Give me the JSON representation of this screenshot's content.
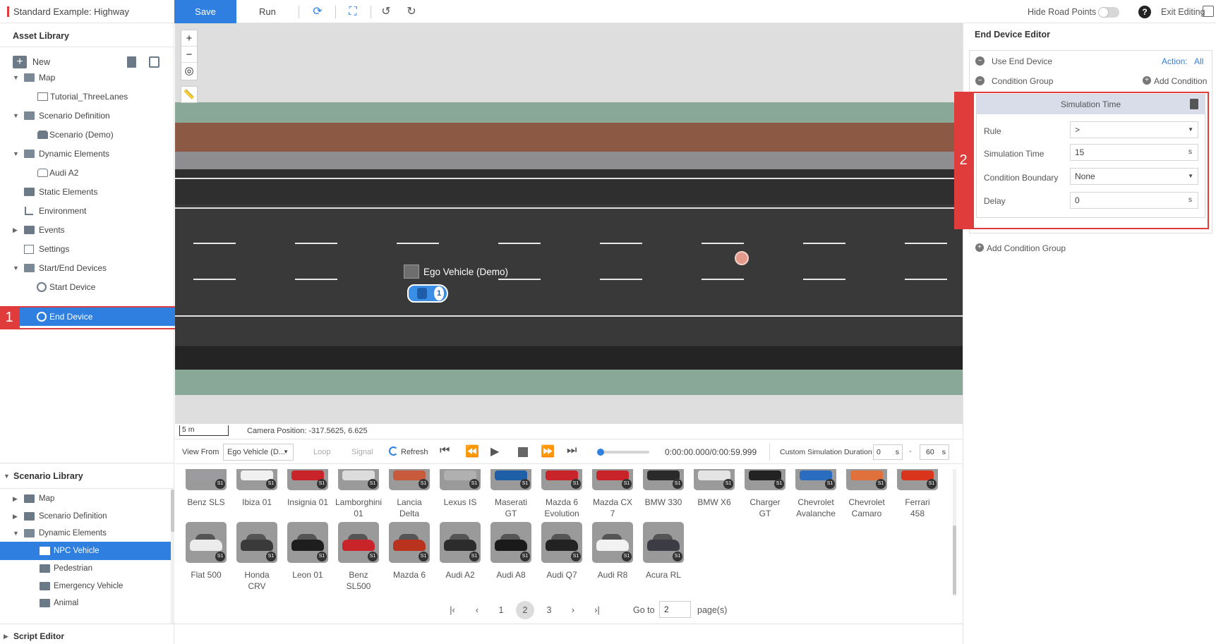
{
  "app": {
    "title": "Standard Example: Highway"
  },
  "toolbar": {
    "save_label": "Save",
    "run_label": "Run",
    "hide_road_points_label": "Hide Road Points",
    "help_label": "?",
    "exit_editing_label": "Exit Editing"
  },
  "asset_library": {
    "title": "Asset Library",
    "new_label": "New",
    "tree": [
      {
        "label": "Map"
      },
      {
        "label": "Tutorial_ThreeLanes"
      },
      {
        "label": "Scenario Definition"
      },
      {
        "label": "Scenario (Demo)"
      },
      {
        "label": "Dynamic Elements"
      },
      {
        "label": "Audi A2"
      },
      {
        "label": "Static Elements"
      },
      {
        "label": "Environment"
      },
      {
        "label": "Events"
      },
      {
        "label": "Settings"
      },
      {
        "label": "Start/End Devices"
      },
      {
        "label": "Start Device"
      },
      {
        "label": "End Device"
      }
    ]
  },
  "annotations": {
    "marker1": "1",
    "marker2": "2"
  },
  "viewport": {
    "zoom_in": "+",
    "zoom_out": "−",
    "ego_label": "Ego Vehicle (Demo)",
    "ego_number": "1",
    "scale_label": "5 m",
    "camera_position": "Camera Position: -317.5625, 6.625"
  },
  "playback": {
    "view_from_label": "View From",
    "view_from_value": "Ego Vehicle (D...",
    "loop_label": "Loop",
    "signal_label": "Signal",
    "refresh_label": "Refresh",
    "time_display": "0:00:00.000/0:00:59.999",
    "custom_duration_label": "Custom Simulation Duration",
    "duration_start": "0",
    "duration_end": "60",
    "unit": "s",
    "dash": "-",
    "progress": 0
  },
  "scenario_library": {
    "title": "Scenario Library",
    "tree": [
      {
        "label": "Map"
      },
      {
        "label": "Scenario Definition"
      },
      {
        "label": "Dynamic Elements"
      },
      {
        "label": "NPC Vehicle"
      },
      {
        "label": "Pedestrian"
      },
      {
        "label": "Emergency Vehicle"
      },
      {
        "label": "Animal"
      }
    ],
    "badge": "S1",
    "row1": [
      {
        "line1": "Benz SLS",
        "line2": "",
        "color": "#9c9ca0"
      },
      {
        "line1": "Ibiza 01",
        "line2": "",
        "color": "#f0f0f0"
      },
      {
        "line1": "Insignia 01",
        "line2": "",
        "color": "#c8242a"
      },
      {
        "line1": "Lamborghini",
        "line2": "01",
        "color": "#dcdcdc"
      },
      {
        "line1": "Lancia",
        "line2": "Delta",
        "color": "#c85a3c"
      },
      {
        "line1": "Lexus IS",
        "line2": "",
        "color": "#b0b0b0"
      },
      {
        "line1": "Maserati",
        "line2": "GT",
        "color": "#1f5fa8"
      },
      {
        "line1": "Mazda 6",
        "line2": "Evolution",
        "color": "#c8242a"
      },
      {
        "line1": "Mazda CX",
        "line2": "7",
        "color": "#c8242a"
      },
      {
        "line1": "BMW 330",
        "line2": "",
        "color": "#2a2a2a"
      },
      {
        "line1": "BMW X6",
        "line2": "",
        "color": "#e4e4e4"
      },
      {
        "line1": "Charger",
        "line2": "GT",
        "color": "#222222"
      },
      {
        "line1": "Chevrolet",
        "line2": "Avalanche",
        "color": "#2a6cc0"
      },
      {
        "line1": "Chevrolet",
        "line2": "Camaro",
        "color": "#e0703c"
      },
      {
        "line1": "Ferrari",
        "line2": "458",
        "color": "#d8351c"
      }
    ],
    "row2": [
      {
        "line1": "Flat 500",
        "line2": "",
        "color": "#ececec"
      },
      {
        "line1": "Honda",
        "line2": "CRV",
        "color": "#3a3a3a"
      },
      {
        "line1": "Leon 01",
        "line2": "",
        "color": "#1e1e1e"
      },
      {
        "line1": "Benz",
        "line2": "SL500",
        "color": "#c8242a"
      },
      {
        "line1": "Mazda 6",
        "line2": "",
        "color": "#b8321e"
      },
      {
        "line1": "Audi A2",
        "line2": "",
        "color": "#2c2c2c"
      },
      {
        "line1": "Audi A8",
        "line2": "",
        "color": "#1a1a1a"
      },
      {
        "line1": "Audi Q7",
        "line2": "",
        "color": "#222222"
      },
      {
        "line1": "Audi R8",
        "line2": "",
        "color": "#f2f2f2"
      },
      {
        "line1": "Acura RL",
        "line2": "",
        "color": "#3c3c44"
      }
    ],
    "pagination": {
      "pages": [
        "1",
        "2",
        "3"
      ],
      "current": "2",
      "go_to_label": "Go to",
      "go_to_value": "2",
      "pages_suffix": "page(s)"
    }
  },
  "script_editor": {
    "title": "Script Editor"
  },
  "end_device_editor": {
    "title": "End Device Editor",
    "use_end_device": "Use End Device",
    "action_label": "Action:",
    "action_value": "All",
    "condition_group": "Condition Group",
    "add_condition": "Add Condition",
    "condition_header": "Simulation Time",
    "rule_label": "Rule",
    "rule_value": ">",
    "sim_time_label": "Simulation Time",
    "sim_time_value": "15",
    "sim_time_unit": "s",
    "boundary_label": "Condition Boundary",
    "boundary_value": "None",
    "delay_label": "Delay",
    "delay_value": "0",
    "delay_unit": "s",
    "add_condition_group": "Add Condition Group"
  }
}
